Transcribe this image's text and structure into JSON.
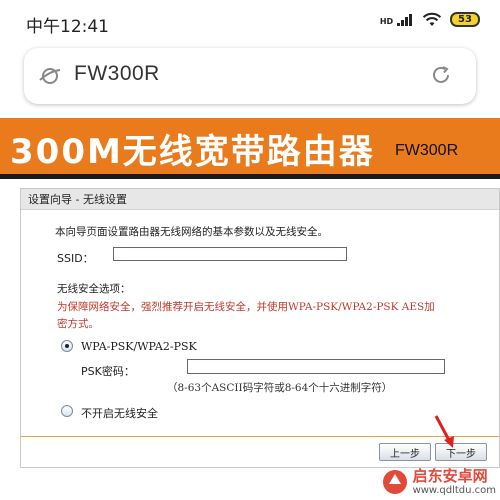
{
  "status_bar": {
    "time": "中午12:41",
    "network": "HD",
    "battery": "53"
  },
  "search": {
    "text": "FW300R"
  },
  "banner": {
    "title": "300M无线宽带路由器",
    "model": "FW300R"
  },
  "setup": {
    "title": "设置向导 - 无线设置",
    "intro": "本向导页面设置路由器无线网络的基本参数以及无线安全。",
    "ssid_label": "SSID：",
    "ssid_value": "",
    "security_label": "无线安全选项：",
    "warning_line1": "为保障网络安全，强烈推荐开启无线安全，并使用WPA-PSK/WPA2-PSK AES加",
    "warning_line2": "密方式。",
    "option_wpa": "WPA-PSK/WPA2-PSK",
    "psk_label": "PSK密码：",
    "psk_value": "",
    "psk_hint": "（8-63个ASCII码字符或8-64个十六进制字符）",
    "option_none": "不开启无线安全",
    "prev_button": "上一步",
    "next_button": "下一步"
  },
  "watermark": {
    "name": "启东安卓网",
    "url": "www.qdltdu.com"
  },
  "colors": {
    "banner": "#e97b1c",
    "warning": "#c0392b",
    "divider": "#e8a640",
    "battery": "#f5d22a"
  }
}
